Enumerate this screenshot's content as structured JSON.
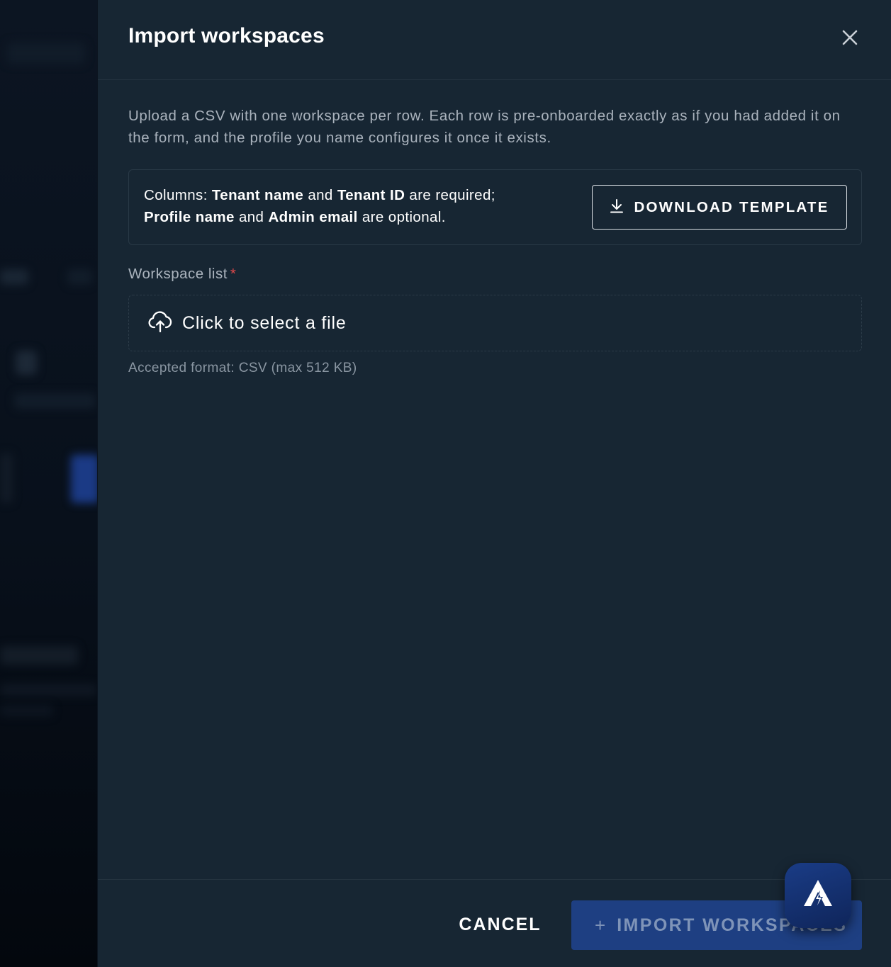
{
  "drawer": {
    "title": "Import workspaces",
    "close_icon": "close-icon",
    "description": "Upload a CSV with one workspace per row. Each row is pre-onboarded exactly as if you had added it on the form, and the profile you name configures it once it exists."
  },
  "columns_info": {
    "prefix": "Columns: ",
    "tenant_name": "Tenant name",
    "and_1": " and ",
    "tenant_id": "Tenant ID",
    "required_suffix": " are required;",
    "profile_name": "Profile name",
    "and_2": " and ",
    "admin_email": "Admin email",
    "optional_suffix": " are optional.",
    "download_label": "DOWNLOAD TEMPLATE",
    "download_icon": "download-icon"
  },
  "workspace_list": {
    "label": "Workspace list",
    "required_mark": "*",
    "upload_icon": "cloud-upload-icon",
    "placeholder": "Click to select a file",
    "helper": "Accepted format: CSV (max 512 KB)"
  },
  "footer": {
    "cancel_label": "CANCEL",
    "import_plus": "+",
    "import_label": "IMPORT WORKSPACES"
  },
  "assistant": {
    "icon": "assistant-logo-icon"
  },
  "colors": {
    "drawer_bg": "#172633",
    "primary_button": "#1e3f82",
    "required": "#e0494b"
  }
}
